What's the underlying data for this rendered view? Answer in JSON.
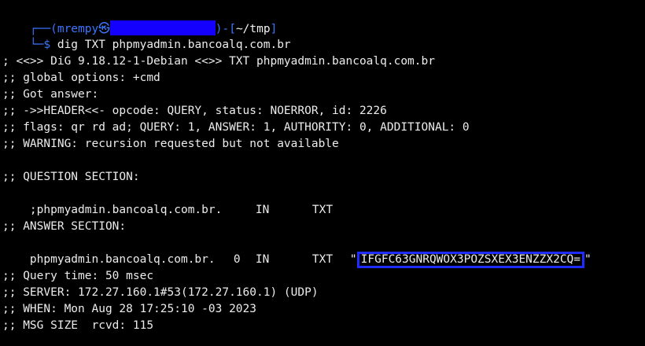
{
  "prompt": {
    "open": "┌──(",
    "user": "mrempy",
    "at": "㉿",
    "close": ")-[",
    "dir": "~/tmp",
    "end": "]",
    "dollar": "└─$ ",
    "command": "dig TXT phpmyadmin.bancoalq.com.br"
  },
  "output": {
    "banner": "; <<>> DiG 9.18.12-1-Debian <<>> TXT phpmyadmin.bancoalq.com.br",
    "global": ";; global options: +cmd",
    "got": ";; Got answer:",
    "header": ";; ->>HEADER<<- opcode: QUERY, status: NOERROR, id: 2226",
    "flags": ";; flags: qr rd ad; QUERY: 1, ANSWER: 1, AUTHORITY: 0, ADDITIONAL: 0",
    "warning": ";; WARNING: recursion requested but not available",
    "question_header": ";; QUESTION SECTION:",
    "question_name": ";phpmyadmin.bancoalq.com.br.",
    "question_class": "IN",
    "question_type": "TXT",
    "answer_header": ";; ANSWER SECTION:",
    "answer_name": "phpmyadmin.bancoalq.com.br.",
    "answer_ttl": "0",
    "answer_class": "IN",
    "answer_type": "TXT",
    "answer_value": "IFGFC63GNRQWOX3POZSXEX3ENZZX2CQ=",
    "query_time": ";; Query time: 50 msec",
    "server": ";; SERVER: 172.27.160.1#53(172.27.160.1) (UDP)",
    "when": ";; WHEN: Mon Aug 28 17:25:10 -03 2023",
    "msg_size": ";; MSG SIZE  rcvd: 115"
  },
  "colors": {
    "background": "#000000",
    "prompt_blue": "#3b76ff",
    "redaction": "#1400ff",
    "highlight_box": "#1e2cff"
  }
}
